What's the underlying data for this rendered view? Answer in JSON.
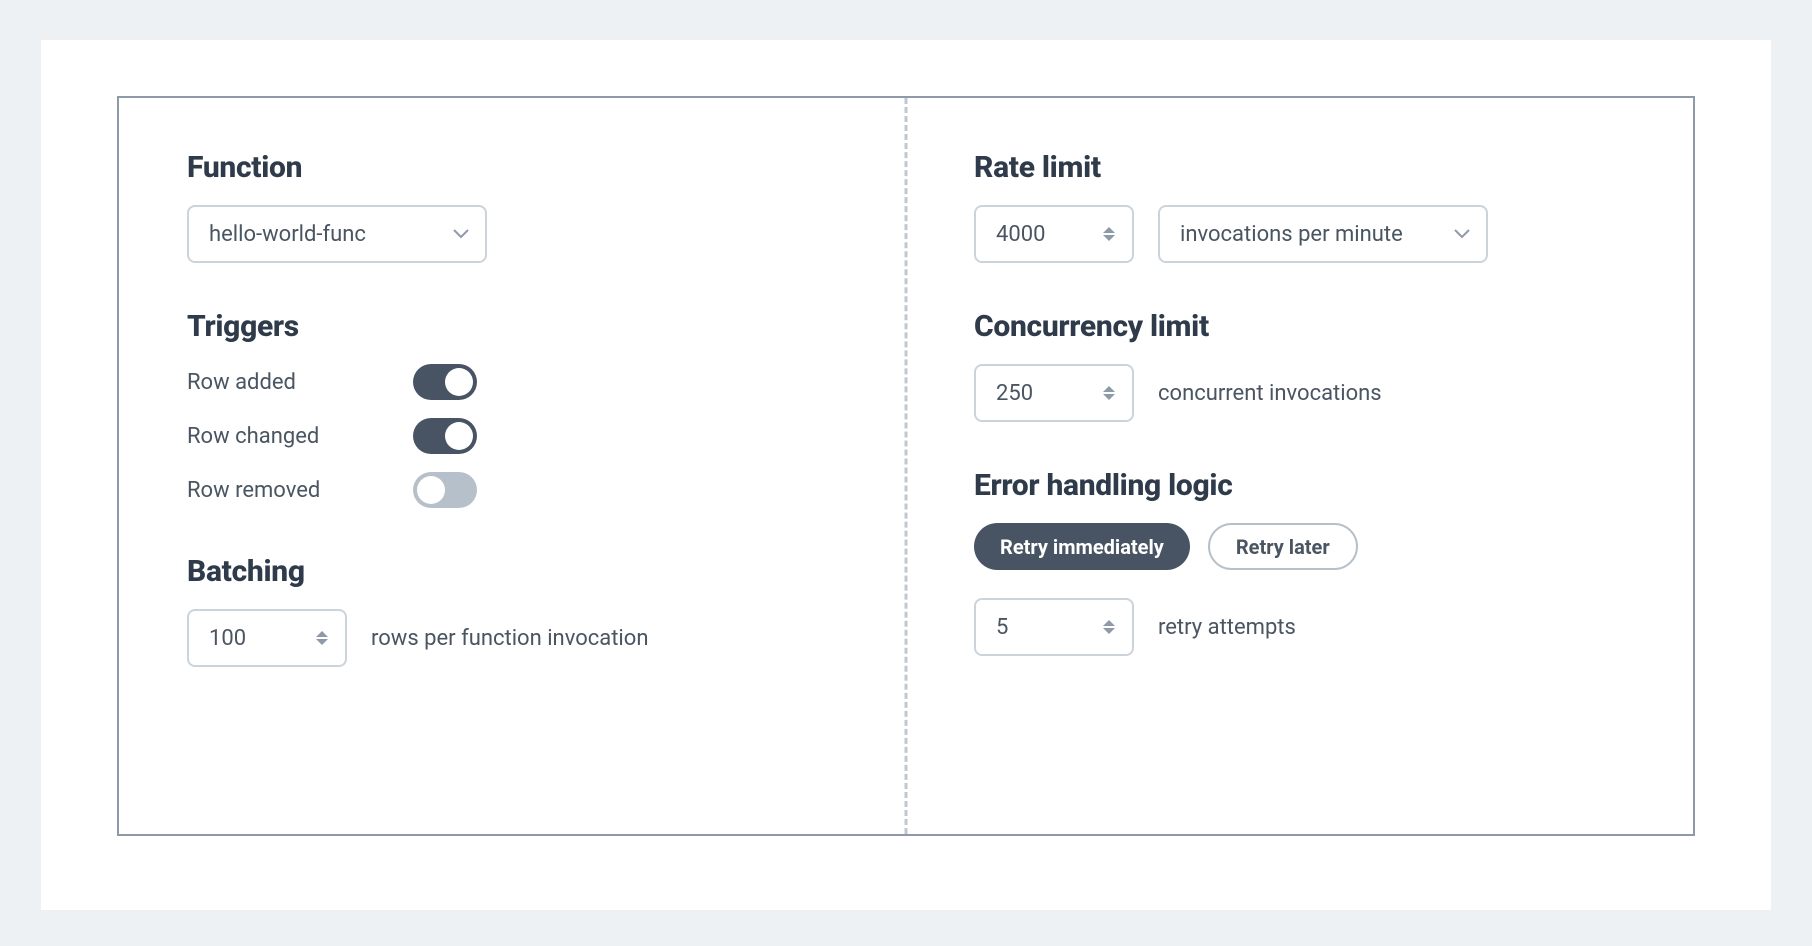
{
  "left": {
    "function": {
      "title": "Function",
      "selected": "hello-world-func"
    },
    "triggers": {
      "title": "Triggers",
      "items": [
        {
          "label": "Row added",
          "on": true
        },
        {
          "label": "Row changed",
          "on": true
        },
        {
          "label": "Row removed",
          "on": false
        }
      ]
    },
    "batching": {
      "title": "Batching",
      "value": "100",
      "suffix": "rows per function invocation"
    }
  },
  "right": {
    "rate_limit": {
      "title": "Rate limit",
      "value": "4000",
      "unit_selected": "invocations per minute"
    },
    "concurrency": {
      "title": "Concurrency limit",
      "value": "250",
      "suffix": "concurrent invocations"
    },
    "error_handling": {
      "title": "Error handling logic",
      "options": [
        {
          "label": "Retry immediately",
          "selected": true
        },
        {
          "label": "Retry later",
          "selected": false
        }
      ],
      "attempts_value": "5",
      "attempts_suffix": "retry attempts"
    }
  }
}
